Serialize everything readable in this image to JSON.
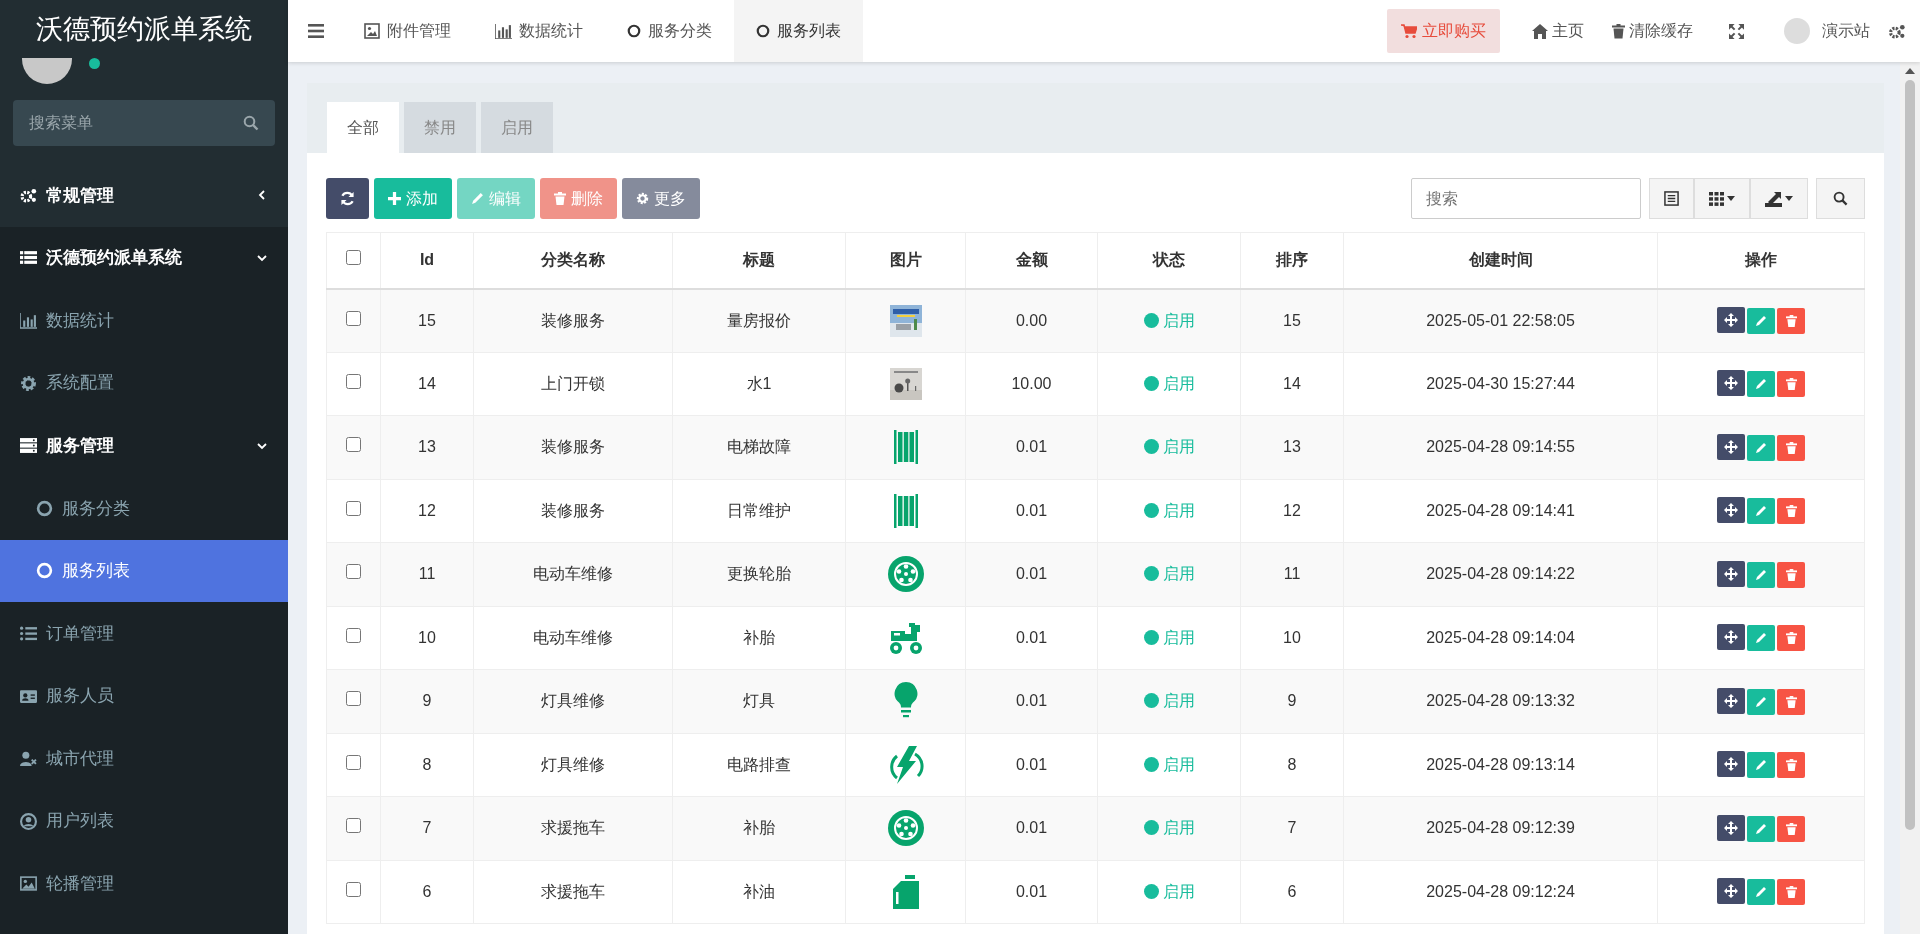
{
  "sidebar": {
    "logo": "沃德预约派单系统",
    "search": {
      "placeholder": "搜索菜单"
    },
    "items": [
      {
        "label": "常规管理",
        "expanded": false,
        "selected": false
      },
      {
        "label": "沃德预约派单系统",
        "expanded": true,
        "selected": false,
        "children": [
          {
            "label": "数据统计",
            "selected": false
          },
          {
            "label": "系统配置",
            "selected": false
          },
          {
            "label": "服务管理",
            "expanded": true,
            "selected": false,
            "children": [
              {
                "label": "服务分类",
                "selected": false
              },
              {
                "label": "服务列表",
                "selected": true
              }
            ]
          },
          {
            "label": "订单管理",
            "selected": false
          },
          {
            "label": "服务人员",
            "selected": false
          },
          {
            "label": "城市代理",
            "selected": false
          },
          {
            "label": "用户列表",
            "selected": false
          },
          {
            "label": "轮播管理",
            "selected": false
          }
        ]
      }
    ]
  },
  "topbar": {
    "tabs": [
      {
        "label": "附件管理",
        "selected": false
      },
      {
        "label": "数据统计",
        "selected": false
      },
      {
        "label": "服务分类",
        "selected": false
      },
      {
        "label": "服务列表",
        "selected": true
      }
    ],
    "buy_button": "立即购买",
    "links": [
      "主页",
      "清除缓存"
    ],
    "user": "演示站"
  },
  "panel": {
    "tabs": [
      {
        "label": "全部",
        "selected": true
      },
      {
        "label": "禁用",
        "selected": false
      },
      {
        "label": "启用",
        "selected": false
      }
    ],
    "toolbar": [
      {
        "kind": "add",
        "label": "添加",
        "disabled": false
      },
      {
        "kind": "edit",
        "label": "编辑",
        "disabled": true
      },
      {
        "kind": "delete",
        "label": "删除",
        "disabled": true
      },
      {
        "kind": "more",
        "label": "更多",
        "disabled": false
      }
    ],
    "search": {
      "placeholder": "搜索"
    }
  },
  "table": {
    "select_all": {
      "checked": false
    },
    "columns": [
      "Id",
      "分类名称",
      "标题",
      "图片",
      "金额",
      "状态",
      "排序",
      "创建时间",
      "操作"
    ],
    "rows": [
      {
        "checked": false,
        "id": "15",
        "category": "装修服务",
        "title": "量房报价",
        "kind": "picture",
        "amount": "0.00",
        "status": "启用",
        "sort": "15",
        "created": "2025-05-01 22:58:05"
      },
      {
        "checked": false,
        "id": "14",
        "category": "上门开锁",
        "title": "水1",
        "kind": "picture",
        "amount": "10.00",
        "status": "启用",
        "sort": "14",
        "created": "2025-04-30 15:27:44"
      },
      {
        "checked": false,
        "id": "13",
        "category": "装修服务",
        "title": "电梯故障",
        "kind": "elevator",
        "amount": "0.01",
        "status": "启用",
        "sort": "13",
        "created": "2025-04-28 09:14:55"
      },
      {
        "checked": false,
        "id": "12",
        "category": "装修服务",
        "title": "日常维护",
        "kind": "elevator",
        "amount": "0.01",
        "status": "启用",
        "sort": "12",
        "created": "2025-04-28 09:14:41"
      },
      {
        "checked": false,
        "id": "11",
        "category": "电动车维修",
        "title": "更换轮胎",
        "kind": "tire",
        "amount": "0.01",
        "status": "启用",
        "sort": "11",
        "created": "2025-04-28 09:14:22"
      },
      {
        "checked": false,
        "id": "10",
        "category": "电动车维修",
        "title": "补胎",
        "kind": "scooter",
        "amount": "0.01",
        "status": "启用",
        "sort": "10",
        "created": "2025-04-28 09:14:04"
      },
      {
        "checked": false,
        "id": "9",
        "category": "灯具维修",
        "title": "灯具",
        "kind": "bulb",
        "amount": "0.01",
        "status": "启用",
        "sort": "9",
        "created": "2025-04-28 09:13:32"
      },
      {
        "checked": false,
        "id": "8",
        "category": "灯具维修",
        "title": "电路排查",
        "kind": "bolt",
        "amount": "0.01",
        "status": "启用",
        "sort": "8",
        "created": "2025-04-28 09:13:14"
      },
      {
        "checked": false,
        "id": "7",
        "category": "求援拖车",
        "title": "补胎",
        "kind": "tire",
        "amount": "0.01",
        "status": "启用",
        "sort": "7",
        "created": "2025-04-28 09:12:39"
      },
      {
        "checked": false,
        "id": "6",
        "category": "求援拖车",
        "title": "补油",
        "kind": "oil",
        "amount": "0.01",
        "status": "启用",
        "sort": "6",
        "created": "2025-04-28 09:12:24"
      }
    ]
  }
}
